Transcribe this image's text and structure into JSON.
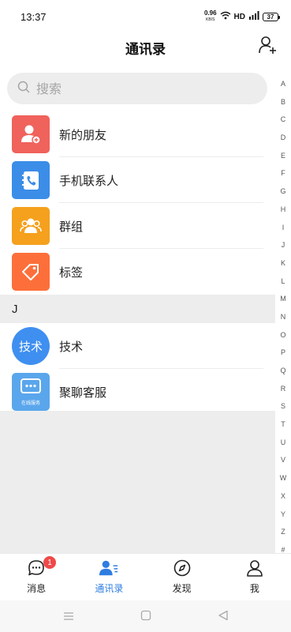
{
  "status_bar": {
    "time": "13:37",
    "net_speed_value": "0.96",
    "net_speed_unit": "KB/S",
    "hd_label": "HD",
    "battery_level": "37"
  },
  "header": {
    "title": "通讯录",
    "add_friend_icon": "add-user-icon"
  },
  "search": {
    "placeholder": "搜索",
    "icon": "search-icon"
  },
  "top_entries": [
    {
      "label": "新的朋友",
      "icon": "new-friend-icon",
      "color": "#f0625c"
    },
    {
      "label": "手机联系人",
      "icon": "phone-contacts-icon",
      "color": "#3b8de8"
    },
    {
      "label": "群组",
      "icon": "group-icon",
      "color": "#f5a11d"
    },
    {
      "label": "标签",
      "icon": "tag-icon",
      "color": "#fd6f3a"
    }
  ],
  "sections": [
    {
      "letter": "J",
      "contacts": [
        {
          "name": "技术",
          "avatar_text": "技术",
          "avatar_color": "#3e8ff0"
        },
        {
          "name": "聚聊客服",
          "avatar_caption": "在线服务",
          "avatar_color": "#5aa6ec"
        }
      ]
    }
  ],
  "index_letters": [
    "A",
    "B",
    "C",
    "D",
    "E",
    "F",
    "G",
    "H",
    "I",
    "J",
    "K",
    "L",
    "M",
    "N",
    "O",
    "P",
    "Q",
    "R",
    "S",
    "T",
    "U",
    "V",
    "W",
    "X",
    "Y",
    "Z",
    "#"
  ],
  "tabs": [
    {
      "label": "消息",
      "icon": "chat-bubble-icon",
      "badge": "1",
      "active": false
    },
    {
      "label": "通讯录",
      "icon": "contacts-icon",
      "active": true
    },
    {
      "label": "发现",
      "icon": "compass-icon",
      "active": false
    },
    {
      "label": "我",
      "icon": "user-icon",
      "active": false
    }
  ],
  "accent_color": "#2f7de1"
}
